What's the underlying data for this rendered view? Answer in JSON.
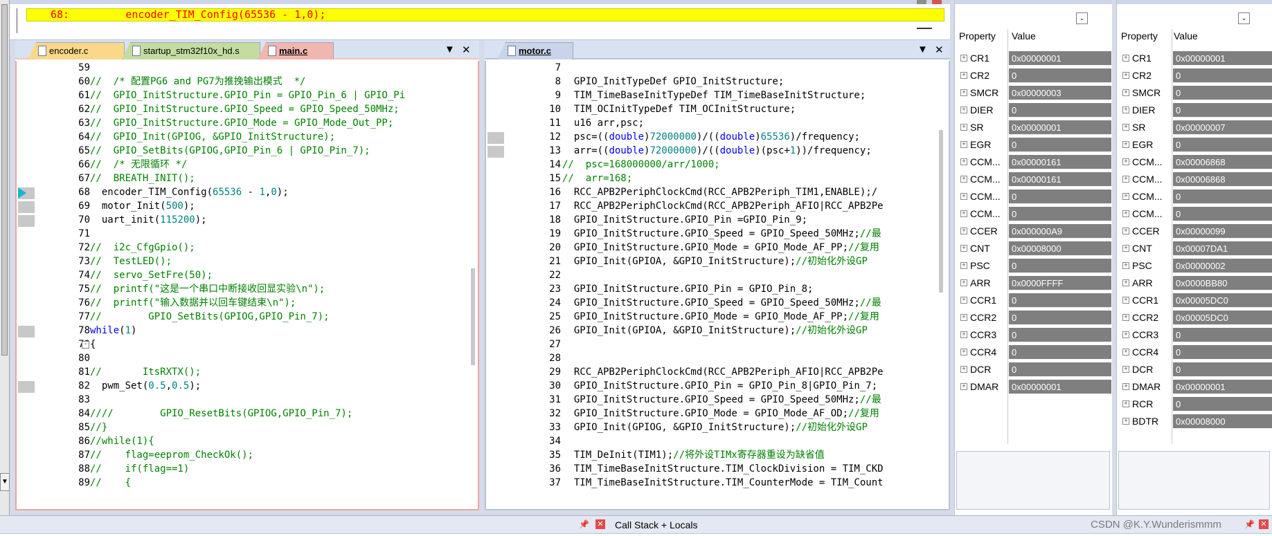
{
  "disassembly": {
    "current_line": "68:         encoder_TIM_Config(65536 - 1,0);"
  },
  "left_editor": {
    "tabs": [
      {
        "label": "encoder.c",
        "color": "#f9d88a",
        "active": false
      },
      {
        "label": "startup_stm32f10x_hd.s",
        "color": "#c5dca0",
        "active": false
      },
      {
        "label": "main.c",
        "color": "#f2b6b0",
        "active": true
      }
    ],
    "lines": [
      {
        "n": "59",
        "mark": false,
        "fold": "",
        "segs": [
          [
            "",
            "#000"
          ]
        ]
      },
      {
        "n": "60",
        "mark": false,
        "fold": "",
        "segs": [
          [
            "//  /* 配置PG6 and PG7为推挽输出模式  */",
            "#008000"
          ]
        ]
      },
      {
        "n": "61",
        "mark": false,
        "fold": "",
        "segs": [
          [
            "//  GPIO_InitStructure.GPIO_Pin = GPIO_Pin_6 | GPIO_Pi",
            "#008000"
          ]
        ]
      },
      {
        "n": "62",
        "mark": false,
        "fold": "",
        "segs": [
          [
            "//  GPIO_InitStructure.GPIO_Speed = GPIO_Speed_50MHz;",
            "#008000"
          ]
        ]
      },
      {
        "n": "63",
        "mark": false,
        "fold": "",
        "segs": [
          [
            "//  GPIO_InitStructure.GPIO_Mode = GPIO_Mode_Out_PP;",
            "#008000"
          ]
        ]
      },
      {
        "n": "64",
        "mark": false,
        "fold": "",
        "segs": [
          [
            "//  GPIO_Init(GPIOG, &GPIO_InitStructure);",
            "#008000"
          ]
        ]
      },
      {
        "n": "65",
        "mark": false,
        "fold": "",
        "segs": [
          [
            "//  GPIO_SetBits(GPIOG,GPIO_Pin_6 | GPIO_Pin_7);",
            "#008000"
          ]
        ]
      },
      {
        "n": "66",
        "mark": false,
        "fold": "",
        "segs": [
          [
            "//  /* 无限循环 */",
            "#008000"
          ]
        ]
      },
      {
        "n": "67",
        "mark": false,
        "fold": "",
        "segs": [
          [
            "//  BREATH_INIT();",
            "#008000"
          ]
        ]
      },
      {
        "n": "68",
        "mark": true,
        "arrow": true,
        "fold": "",
        "segs": [
          [
            "  encoder_TIM_Config(",
            "#000"
          ],
          [
            "65536",
            "#008080"
          ],
          [
            " - ",
            "#000"
          ],
          [
            "1",
            "#008080"
          ],
          [
            ",",
            "#000"
          ],
          [
            "0",
            "#008080"
          ],
          [
            ");",
            "#000"
          ]
        ]
      },
      {
        "n": "69",
        "mark": true,
        "fold": "",
        "segs": [
          [
            "  motor_Init(",
            "#000"
          ],
          [
            "500",
            "#008080"
          ],
          [
            ");",
            "#000"
          ]
        ]
      },
      {
        "n": "70",
        "mark": true,
        "fold": "",
        "segs": [
          [
            "  uart_init(",
            "#000"
          ],
          [
            "115200",
            "#008080"
          ],
          [
            ");",
            "#000"
          ]
        ]
      },
      {
        "n": "71",
        "mark": false,
        "fold": "",
        "segs": [
          [
            "",
            "#000"
          ]
        ]
      },
      {
        "n": "72",
        "mark": false,
        "fold": "",
        "segs": [
          [
            "//  i2c_CfgGpio();",
            "#008000"
          ]
        ]
      },
      {
        "n": "73",
        "mark": false,
        "fold": "",
        "segs": [
          [
            "//  TestLED();",
            "#008000"
          ]
        ]
      },
      {
        "n": "74",
        "mark": false,
        "fold": "",
        "segs": [
          [
            "//  servo_SetFre(50);",
            "#008000"
          ]
        ]
      },
      {
        "n": "75",
        "mark": false,
        "fold": "",
        "segs": [
          [
            "//  printf(\"这是一个串口中断接收回显实验\\n\");",
            "#008000"
          ]
        ]
      },
      {
        "n": "76",
        "mark": false,
        "fold": "",
        "segs": [
          [
            "//  printf(\"输入数据并以回车键结束\\n\");",
            "#008000"
          ]
        ]
      },
      {
        "n": "77",
        "mark": false,
        "fold": "",
        "segs": [
          [
            "//        GPIO_SetBits(GPIOG,GPIO_Pin_7);",
            "#008000"
          ]
        ]
      },
      {
        "n": "78",
        "mark": true,
        "fold": "",
        "segs": [
          [
            "while",
            "#0000ff"
          ],
          [
            "(",
            "#000"
          ],
          [
            "1",
            "#008080"
          ],
          [
            ")",
            "#000"
          ]
        ]
      },
      {
        "n": "79",
        "mark": false,
        "fold": "-",
        "segs": [
          [
            "{",
            "#000"
          ]
        ]
      },
      {
        "n": "80",
        "mark": false,
        "fold": "",
        "segs": [
          [
            "",
            "#000"
          ]
        ]
      },
      {
        "n": "81",
        "mark": false,
        "fold": "",
        "segs": [
          [
            "//       ItsRXTX();",
            "#008000"
          ]
        ]
      },
      {
        "n": "82",
        "mark": true,
        "fold": "",
        "segs": [
          [
            "  pwm_Set(",
            "#000"
          ],
          [
            "0.5",
            "#008080"
          ],
          [
            ",",
            "#000"
          ],
          [
            "0.5",
            "#008080"
          ],
          [
            ");",
            "#000"
          ]
        ]
      },
      {
        "n": "83",
        "mark": false,
        "fold": "",
        "segs": [
          [
            "",
            "#000"
          ]
        ]
      },
      {
        "n": "84",
        "mark": false,
        "fold": "",
        "segs": [
          [
            "////        GPIO_ResetBits(GPIOG,GPIO_Pin_7);",
            "#008000"
          ]
        ]
      },
      {
        "n": "85",
        "mark": false,
        "fold": "",
        "segs": [
          [
            "//}",
            "#008000"
          ]
        ]
      },
      {
        "n": "86",
        "mark": false,
        "fold": "",
        "segs": [
          [
            "//while(1){",
            "#008000"
          ]
        ]
      },
      {
        "n": "87",
        "mark": false,
        "fold": "",
        "segs": [
          [
            "//    flag=eeprom_CheckOk();",
            "#008000"
          ]
        ]
      },
      {
        "n": "88",
        "mark": false,
        "fold": "",
        "segs": [
          [
            "//    if(flag==1)",
            "#008000"
          ]
        ]
      },
      {
        "n": "89",
        "mark": false,
        "fold": "",
        "segs": [
          [
            "//    {",
            "#008000"
          ]
        ]
      }
    ]
  },
  "right_editor": {
    "tabs": [
      {
        "label": "motor.c",
        "color": "#c9d3ea",
        "active": true
      }
    ],
    "lines": [
      {
        "n": "7",
        "segs": [
          [
            "",
            "#000"
          ]
        ]
      },
      {
        "n": "8",
        "segs": [
          [
            "  GPIO_InitTypeDef GPIO_InitStructure;",
            "#000"
          ]
        ]
      },
      {
        "n": "9",
        "segs": [
          [
            "  TIM_TimeBaseInitTypeDef TIM_TimeBaseInitStructure;",
            "#000"
          ]
        ]
      },
      {
        "n": "10",
        "segs": [
          [
            "  TIM_OCInitTypeDef TIM_OCInitStructure;",
            "#000"
          ]
        ]
      },
      {
        "n": "11",
        "segs": [
          [
            "  u16 arr,psc;",
            "#000"
          ]
        ]
      },
      {
        "n": "12",
        "mark": true,
        "segs": [
          [
            "  psc=((",
            "#000"
          ],
          [
            "double",
            "#0000ff"
          ],
          [
            ")",
            "#000"
          ],
          [
            "72000000",
            "#008080"
          ],
          [
            ")/((",
            "#000"
          ],
          [
            "double",
            "#0000ff"
          ],
          [
            ")",
            "#000"
          ],
          [
            "65536",
            "#008080"
          ],
          [
            ")/frequency;",
            "#000"
          ]
        ]
      },
      {
        "n": "13",
        "mark": true,
        "segs": [
          [
            "  arr=((",
            "#000"
          ],
          [
            "double",
            "#0000ff"
          ],
          [
            ")",
            "#000"
          ],
          [
            "72000000",
            "#008080"
          ],
          [
            ")/((",
            "#000"
          ],
          [
            "double",
            "#0000ff"
          ],
          [
            ")(psc+",
            "#000"
          ],
          [
            "1",
            "#008080"
          ],
          [
            "))/frequency;",
            "#000"
          ]
        ]
      },
      {
        "n": "14",
        "segs": [
          [
            "//  psc=168000000/arr/1000;",
            "#008000"
          ]
        ]
      },
      {
        "n": "15",
        "segs": [
          [
            "//  arr=168;",
            "#008000"
          ]
        ]
      },
      {
        "n": "16",
        "segs": [
          [
            "  RCC_APB2PeriphClockCmd(RCC_APB2Periph_TIM1,ENABLE);/",
            "#000"
          ]
        ]
      },
      {
        "n": "17",
        "segs": [
          [
            "  RCC_APB2PeriphClockCmd(RCC_APB2Periph_AFIO|RCC_APB2Pe",
            "#000"
          ]
        ]
      },
      {
        "n": "18",
        "segs": [
          [
            "  GPIO_InitStructure.GPIO_Pin =GPIO_Pin_9;",
            "#000"
          ]
        ]
      },
      {
        "n": "19",
        "segs": [
          [
            "  GPIO_InitStructure.GPIO_Speed = GPIO_Speed_50MHz;",
            "#000"
          ],
          [
            "//最",
            "#008000"
          ]
        ]
      },
      {
        "n": "20",
        "segs": [
          [
            "  GPIO_InitStructure.GPIO_Mode = GPIO_Mode_AF_PP;",
            "#000"
          ],
          [
            "//复用",
            "#008000"
          ]
        ]
      },
      {
        "n": "21",
        "segs": [
          [
            "  GPIO_Init(GPIOA, &GPIO_InitStructure);",
            "#000"
          ],
          [
            "//初始化外设GP",
            "#008000"
          ]
        ]
      },
      {
        "n": "22",
        "segs": [
          [
            "",
            "#000"
          ]
        ]
      },
      {
        "n": "23",
        "segs": [
          [
            "  GPIO_InitStructure.GPIO_Pin = GPIO_Pin_8;",
            "#000"
          ]
        ]
      },
      {
        "n": "24",
        "segs": [
          [
            "  GPIO_InitStructure.GPIO_Speed = GPIO_Speed_50MHz;",
            "#000"
          ],
          [
            "//最",
            "#008000"
          ]
        ]
      },
      {
        "n": "25",
        "segs": [
          [
            "  GPIO_InitStructure.GPIO_Mode = GPIO_Mode_AF_PP;",
            "#000"
          ],
          [
            "//复用",
            "#008000"
          ]
        ]
      },
      {
        "n": "26",
        "segs": [
          [
            "  GPIO_Init(GPIOA, &GPIO_InitStructure);",
            "#000"
          ],
          [
            "//初始化外设GP",
            "#008000"
          ]
        ]
      },
      {
        "n": "27",
        "segs": [
          [
            "",
            "#000"
          ]
        ]
      },
      {
        "n": "28",
        "segs": [
          [
            "",
            "#000"
          ]
        ]
      },
      {
        "n": "29",
        "segs": [
          [
            "  RCC_APB2PeriphClockCmd(RCC_APB2Periph_AFIO|RCC_APB2Pe",
            "#000"
          ]
        ]
      },
      {
        "n": "30",
        "segs": [
          [
            "  GPIO_InitStructure.GPIO_Pin = GPIO_Pin_8|GPIO_Pin_7;",
            "#000"
          ]
        ]
      },
      {
        "n": "31",
        "segs": [
          [
            "  GPIO_InitStructure.GPIO_Speed = GPIO_Speed_50MHz;",
            "#000"
          ],
          [
            "//最",
            "#008000"
          ]
        ]
      },
      {
        "n": "32",
        "segs": [
          [
            "  GPIO_InitStructure.GPIO_Mode = GPIO_Mode_AF_OD;",
            "#000"
          ],
          [
            "//复用",
            "#008000"
          ]
        ]
      },
      {
        "n": "33",
        "segs": [
          [
            "  GPIO_Init(GPIOG, &GPIO_InitStructure);",
            "#000"
          ],
          [
            "//初始化外设GP",
            "#008000"
          ]
        ]
      },
      {
        "n": "34",
        "segs": [
          [
            "",
            "#000"
          ]
        ]
      },
      {
        "n": "35",
        "segs": [
          [
            "  TIM_DeInit(TIM1);",
            "#000"
          ],
          [
            "//将外设TIMx寄存器重设为缺省值",
            "#008000"
          ]
        ]
      },
      {
        "n": "36",
        "segs": [
          [
            "  TIM_TimeBaseInitStructure.TIM_ClockDivision = TIM_CKD",
            "#000"
          ]
        ]
      },
      {
        "n": "37",
        "segs": [
          [
            "  TIM_TimeBaseInitStructure.TIM_CounterMode = TIM_Count",
            "#000"
          ]
        ]
      }
    ]
  },
  "reg_panel_1": {
    "header_property": "Property",
    "header_value": "Value",
    "rows": [
      {
        "name": "CR1",
        "value": "0x00000001"
      },
      {
        "name": "CR2",
        "value": "0"
      },
      {
        "name": "SMCR",
        "value": "0x00000003"
      },
      {
        "name": "DIER",
        "value": "0"
      },
      {
        "name": "SR",
        "value": "0x00000001"
      },
      {
        "name": "EGR",
        "value": "0"
      },
      {
        "name": "CCM...",
        "value": "0x00000161"
      },
      {
        "name": "CCM...",
        "value": "0x00000161"
      },
      {
        "name": "CCM...",
        "value": "0"
      },
      {
        "name": "CCM...",
        "value": "0"
      },
      {
        "name": "CCER",
        "value": "0x000000A9"
      },
      {
        "name": "CNT",
        "value": "0x00008000"
      },
      {
        "name": "PSC",
        "value": "0"
      },
      {
        "name": "ARR",
        "value": "0x0000FFFF"
      },
      {
        "name": "CCR1",
        "value": "0"
      },
      {
        "name": "CCR2",
        "value": "0"
      },
      {
        "name": "CCR3",
        "value": "0"
      },
      {
        "name": "CCR4",
        "value": "0"
      },
      {
        "name": "DCR",
        "value": "0"
      },
      {
        "name": "DMAR",
        "value": "0x00000001"
      }
    ]
  },
  "reg_panel_2": {
    "header_property": "Property",
    "header_value": "Value",
    "rows": [
      {
        "name": "CR1",
        "value": "0x00000001"
      },
      {
        "name": "CR2",
        "value": "0"
      },
      {
        "name": "SMCR",
        "value": "0"
      },
      {
        "name": "DIER",
        "value": "0"
      },
      {
        "name": "SR",
        "value": "0x00000007"
      },
      {
        "name": "EGR",
        "value": "0"
      },
      {
        "name": "CCM...",
        "value": "0x00006868"
      },
      {
        "name": "CCM...",
        "value": "0x00006868"
      },
      {
        "name": "CCM...",
        "value": "0"
      },
      {
        "name": "CCM...",
        "value": "0"
      },
      {
        "name": "CCER",
        "value": "0x00000099"
      },
      {
        "name": "CNT",
        "value": "0x00007DA1"
      },
      {
        "name": "PSC",
        "value": "0x00000002"
      },
      {
        "name": "ARR",
        "value": "0x0000BB80"
      },
      {
        "name": "CCR1",
        "value": "0x00005DC0"
      },
      {
        "name": "CCR2",
        "value": "0x00005DC0"
      },
      {
        "name": "CCR3",
        "value": "0"
      },
      {
        "name": "CCR4",
        "value": "0"
      },
      {
        "name": "DCR",
        "value": "0"
      },
      {
        "name": "DMAR",
        "value": "0x00000001"
      },
      {
        "name": "RCR",
        "value": "0"
      },
      {
        "name": "BDTR",
        "value": "0x00008000"
      }
    ]
  },
  "bottom": {
    "call_stack_title": "Call Stack + Locals",
    "watermark": "CSDN @K.Y.Wunderismmm"
  }
}
